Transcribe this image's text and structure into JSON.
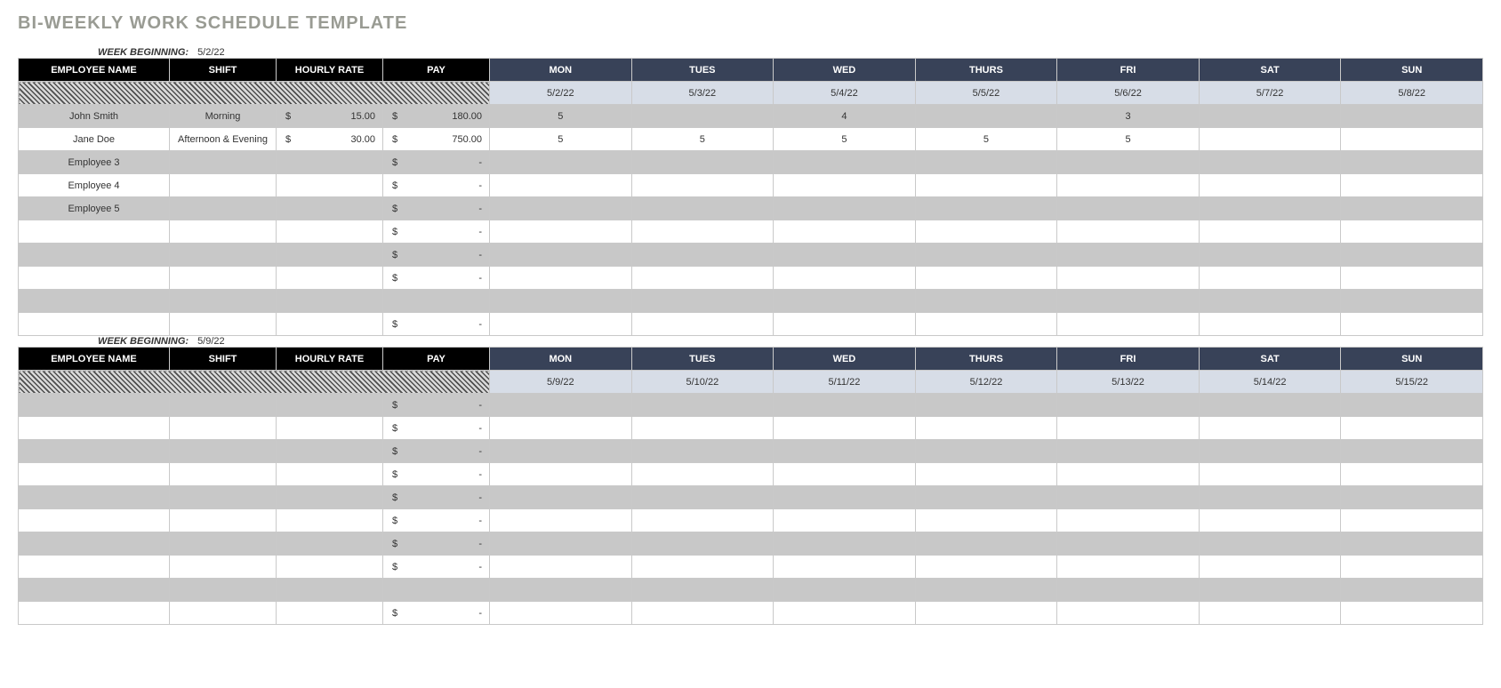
{
  "title": "BI-WEEKLY WORK SCHEDULE TEMPLATE",
  "week_beginning_label": "WEEK BEGINNING:",
  "headers": {
    "employee": "EMPLOYEE NAME",
    "shift": "SHIFT",
    "rate": "HOURLY RATE",
    "pay": "PAY",
    "days": [
      "MON",
      "TUES",
      "WED",
      "THURS",
      "FRI",
      "SAT",
      "SUN"
    ]
  },
  "weeks": [
    {
      "beginning": "5/2/22",
      "dates": [
        "5/2/22",
        "5/3/22",
        "5/4/22",
        "5/5/22",
        "5/6/22",
        "5/7/22",
        "5/8/22"
      ],
      "rows": [
        {
          "name": "John Smith",
          "shift": "Morning",
          "rate": "15.00",
          "pay": "180.00",
          "hours": [
            "5",
            "",
            "4",
            "",
            "3",
            "",
            ""
          ]
        },
        {
          "name": "Jane Doe",
          "shift": "Afternoon & Evening",
          "rate": "30.00",
          "pay": "750.00",
          "hours": [
            "5",
            "5",
            "5",
            "5",
            "5",
            "",
            ""
          ]
        },
        {
          "name": "Employee 3",
          "shift": "",
          "rate": "",
          "pay": "-",
          "hours": [
            "",
            "",
            "",
            "",
            "",
            "",
            ""
          ]
        },
        {
          "name": "Employee 4",
          "shift": "",
          "rate": "",
          "pay": "-",
          "hours": [
            "",
            "",
            "",
            "",
            "",
            "",
            ""
          ]
        },
        {
          "name": "Employee 5",
          "shift": "",
          "rate": "",
          "pay": "-",
          "hours": [
            "",
            "",
            "",
            "",
            "",
            "",
            ""
          ]
        },
        {
          "name": "",
          "shift": "",
          "rate": "",
          "pay": "-",
          "hours": [
            "",
            "",
            "",
            "",
            "",
            "",
            ""
          ]
        },
        {
          "name": "",
          "shift": "",
          "rate": "",
          "pay": "-",
          "hours": [
            "",
            "",
            "",
            "",
            "",
            "",
            ""
          ]
        },
        {
          "name": "",
          "shift": "",
          "rate": "",
          "pay": "-",
          "hours": [
            "",
            "",
            "",
            "",
            "",
            "",
            ""
          ]
        },
        {
          "name": "",
          "shift": "",
          "rate": "",
          "pay": "",
          "hours": [
            "",
            "",
            "",
            "",
            "",
            "",
            ""
          ]
        },
        {
          "name": "",
          "shift": "",
          "rate": "",
          "pay": "-",
          "hours": [
            "",
            "",
            "",
            "",
            "",
            "",
            ""
          ]
        }
      ]
    },
    {
      "beginning": "5/9/22",
      "dates": [
        "5/9/22",
        "5/10/22",
        "5/11/22",
        "5/12/22",
        "5/13/22",
        "5/14/22",
        "5/15/22"
      ],
      "rows": [
        {
          "name": "",
          "shift": "",
          "rate": "",
          "pay": "-",
          "hours": [
            "",
            "",
            "",
            "",
            "",
            "",
            ""
          ]
        },
        {
          "name": "",
          "shift": "",
          "rate": "",
          "pay": "-",
          "hours": [
            "",
            "",
            "",
            "",
            "",
            "",
            ""
          ]
        },
        {
          "name": "",
          "shift": "",
          "rate": "",
          "pay": "-",
          "hours": [
            "",
            "",
            "",
            "",
            "",
            "",
            ""
          ]
        },
        {
          "name": "",
          "shift": "",
          "rate": "",
          "pay": "-",
          "hours": [
            "",
            "",
            "",
            "",
            "",
            "",
            ""
          ]
        },
        {
          "name": "",
          "shift": "",
          "rate": "",
          "pay": "-",
          "hours": [
            "",
            "",
            "",
            "",
            "",
            "",
            ""
          ]
        },
        {
          "name": "",
          "shift": "",
          "rate": "",
          "pay": "-",
          "hours": [
            "",
            "",
            "",
            "",
            "",
            "",
            ""
          ]
        },
        {
          "name": "",
          "shift": "",
          "rate": "",
          "pay": "-",
          "hours": [
            "",
            "",
            "",
            "",
            "",
            "",
            ""
          ]
        },
        {
          "name": "",
          "shift": "",
          "rate": "",
          "pay": "-",
          "hours": [
            "",
            "",
            "",
            "",
            "",
            "",
            ""
          ]
        },
        {
          "name": "",
          "shift": "",
          "rate": "",
          "pay": "",
          "hours": [
            "",
            "",
            "",
            "",
            "",
            "",
            ""
          ]
        },
        {
          "name": "",
          "shift": "",
          "rate": "",
          "pay": "-",
          "hours": [
            "",
            "",
            "",
            "",
            "",
            "",
            ""
          ]
        }
      ]
    }
  ]
}
